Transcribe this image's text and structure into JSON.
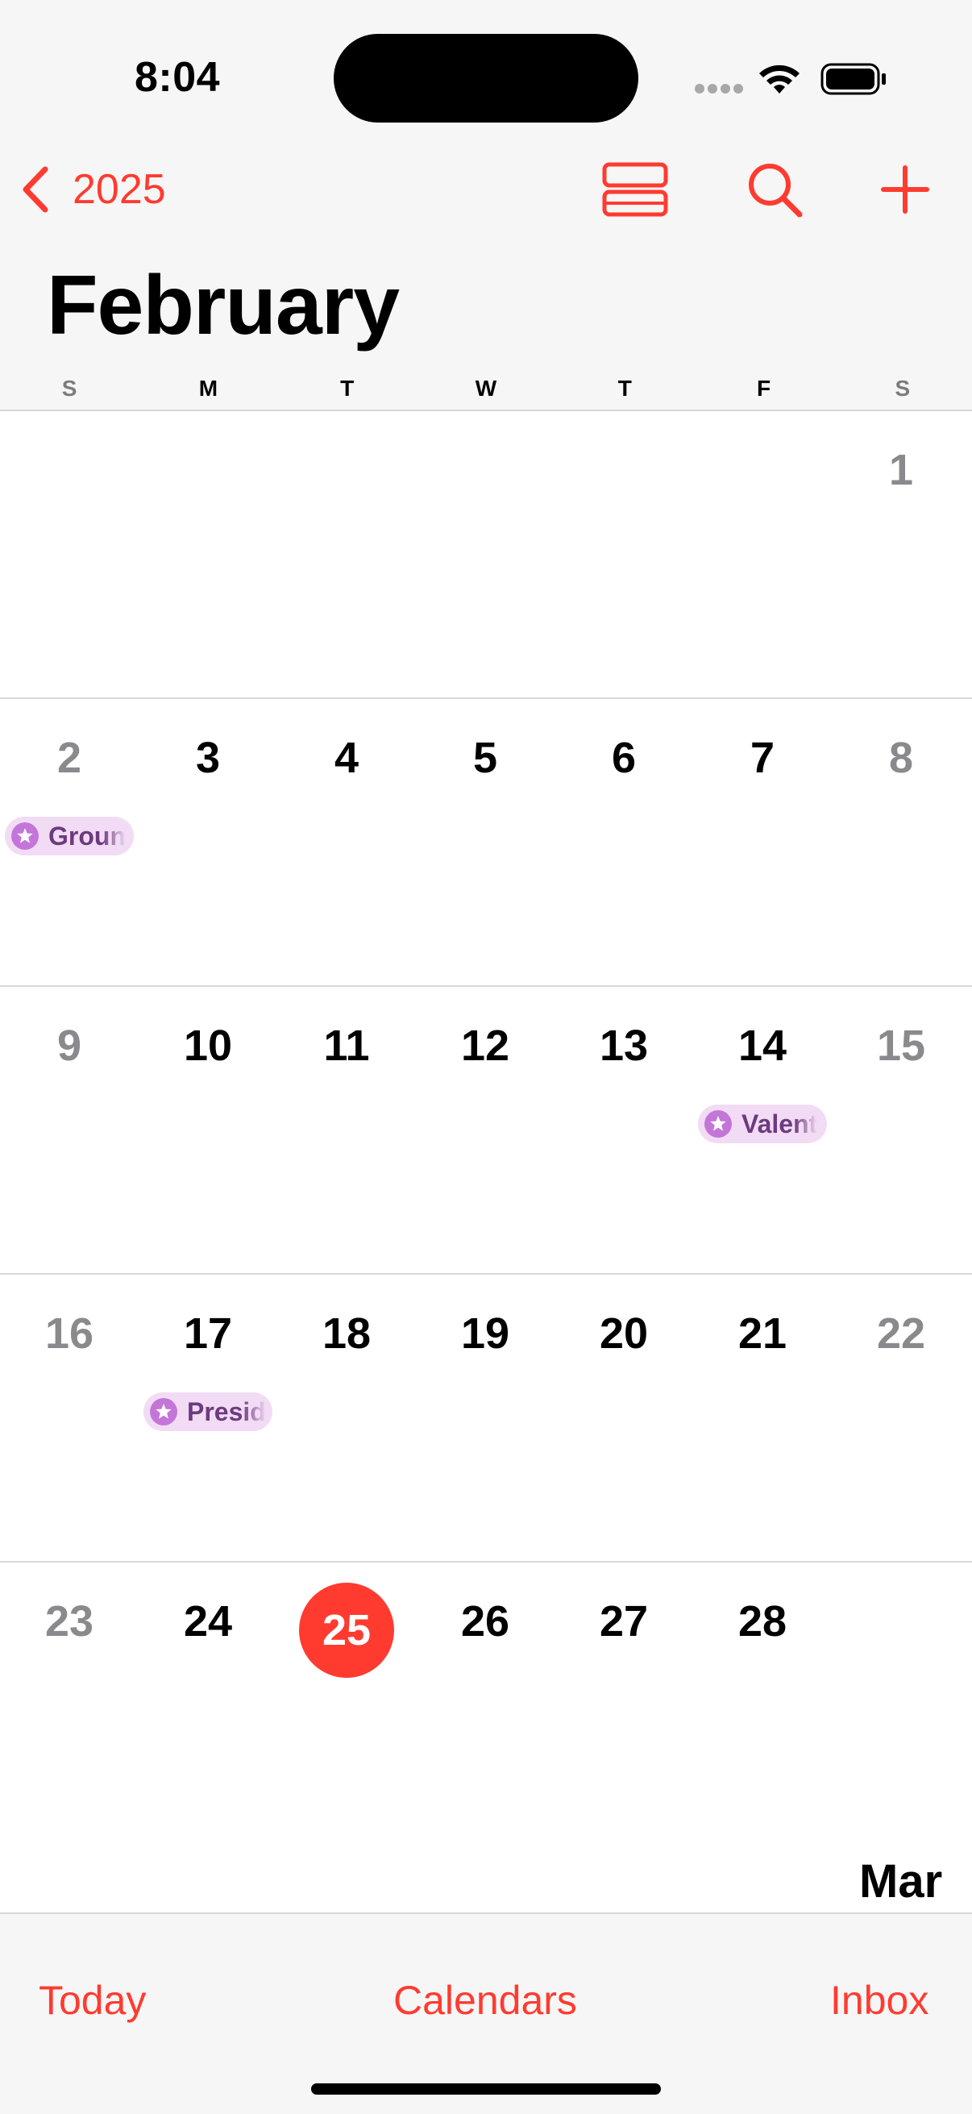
{
  "status_bar": {
    "time": "8:04"
  },
  "nav": {
    "back_label": "2025"
  },
  "calendar": {
    "month_title": "February",
    "weekdays": [
      "S",
      "M",
      "T",
      "W",
      "T",
      "F",
      "S"
    ],
    "weeks": [
      {
        "days": [
          "",
          "",
          "",
          "",
          "",
          "",
          "1"
        ]
      },
      {
        "days": [
          "2",
          "3",
          "4",
          "5",
          "6",
          "7",
          "8"
        ]
      },
      {
        "days": [
          "9",
          "10",
          "11",
          "12",
          "13",
          "14",
          "15"
        ]
      },
      {
        "days": [
          "16",
          "17",
          "18",
          "19",
          "20",
          "21",
          "22"
        ]
      },
      {
        "days": [
          "23",
          "24",
          "25",
          "26",
          "27",
          "28",
          ""
        ]
      }
    ],
    "today": "25",
    "events": [
      {
        "label": "Groun"
      },
      {
        "label": "Valent"
      },
      {
        "label": "Presid"
      }
    ],
    "next_month_label": "Mar"
  },
  "toolbar": {
    "today_label": "Today",
    "calendars_label": "Calendars",
    "inbox_label": "Inbox"
  },
  "colors": {
    "accent": "#ff3b30",
    "event_bg": "#f2dbf4",
    "event_icon": "#c376d8",
    "event_text": "#6d3a80",
    "weekend_text": "#8a8a8e"
  }
}
